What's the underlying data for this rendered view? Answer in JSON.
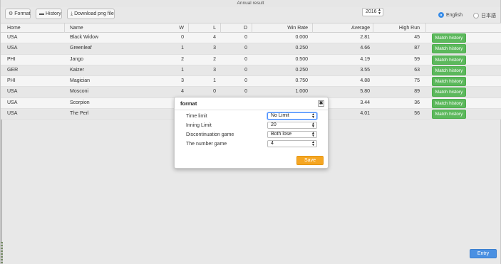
{
  "window": {
    "title": "Annual result"
  },
  "toolbar": {
    "format_label": "Format",
    "history_label": "History",
    "download_label": "Download png file"
  },
  "year": {
    "selected": "2016"
  },
  "language": {
    "english": "English",
    "japanese": "日本語",
    "selected": "English"
  },
  "table": {
    "headers": [
      "Home",
      "Name",
      "W",
      "L",
      "D",
      "Win Rate",
      "Average",
      "High Run"
    ],
    "rows": [
      {
        "home": "USA",
        "name": "Black Widow",
        "w": "0",
        "l": "4",
        "d": "0",
        "win_rate": "0.000",
        "average": "2.81",
        "high_run": "45",
        "action": "Match history"
      },
      {
        "home": "USA",
        "name": "Greenleaf",
        "w": "1",
        "l": "3",
        "d": "0",
        "win_rate": "0.250",
        "average": "4.66",
        "high_run": "87",
        "action": "Match history"
      },
      {
        "home": "PHI",
        "name": "Jango",
        "w": "2",
        "l": "2",
        "d": "0",
        "win_rate": "0.500",
        "average": "4.19",
        "high_run": "59",
        "action": "Match history"
      },
      {
        "home": "GER",
        "name": "Kaizer",
        "w": "1",
        "l": "3",
        "d": "0",
        "win_rate": "0.250",
        "average": "3.55",
        "high_run": "63",
        "action": "Match history"
      },
      {
        "home": "PHI",
        "name": "Magician",
        "w": "3",
        "l": "1",
        "d": "0",
        "win_rate": "0.750",
        "average": "4.88",
        "high_run": "75",
        "action": "Match history"
      },
      {
        "home": "USA",
        "name": "Mosconi",
        "w": "4",
        "l": "0",
        "d": "0",
        "win_rate": "1.000",
        "average": "5.80",
        "high_run": "89",
        "action": "Match history"
      },
      {
        "home": "USA",
        "name": "Scorpion",
        "w": "",
        "l": "",
        "d": "",
        "win_rate": "",
        "average": "3.44",
        "high_run": "36",
        "action": "Match history"
      },
      {
        "home": "USA",
        "name": "The Perl",
        "w": "",
        "l": "",
        "d": "",
        "win_rate": "",
        "average": "4.01",
        "high_run": "56",
        "action": "Match history"
      }
    ]
  },
  "dialog": {
    "title": "format",
    "close": "✖",
    "fields": [
      {
        "label": "Time limit",
        "value": "No Limit"
      },
      {
        "label": "Inning Limit",
        "value": "20"
      },
      {
        "label": "Discontinuation game",
        "value": "Both lose"
      },
      {
        "label": "The number game",
        "value": "4"
      }
    ],
    "save_label": "Save"
  },
  "footer": {
    "entry_label": "Entry"
  },
  "colors": {
    "match_button": "#5cb85c",
    "save_button": "#f5a623",
    "entry_button": "#4a90e2",
    "radio_selected": "#3b8ee8"
  },
  "icons": {
    "format": "gear-icon",
    "history": "folder-icon",
    "download": "download-icon",
    "close": "close-icon"
  }
}
